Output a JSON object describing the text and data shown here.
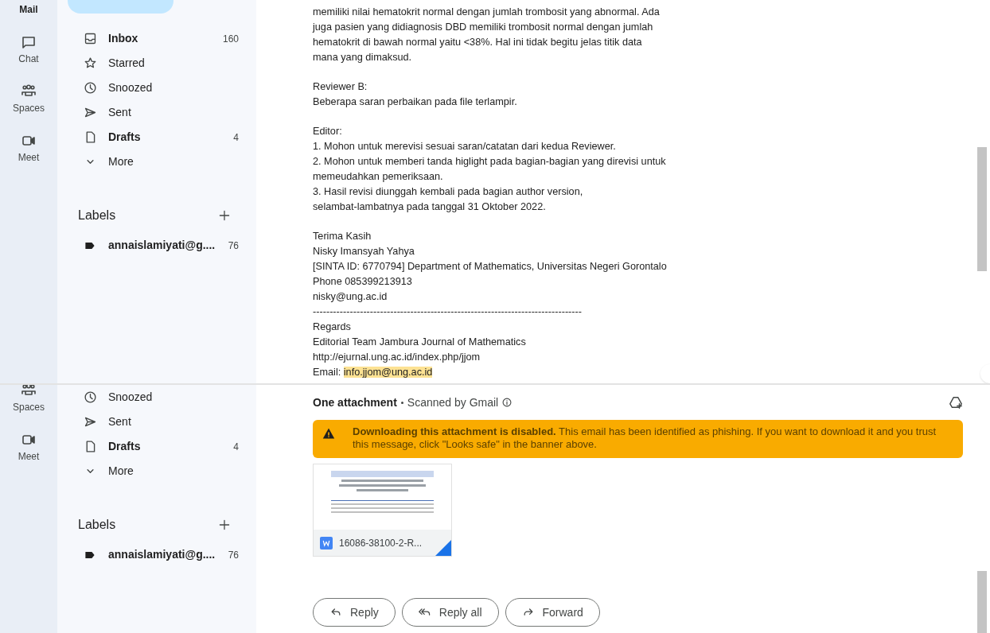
{
  "top_view": {
    "rail": [
      {
        "kind": "mail",
        "label": "Mail"
      },
      {
        "kind": "chat",
        "label": "Chat"
      },
      {
        "kind": "spaces",
        "label": "Spaces"
      },
      {
        "kind": "meet",
        "label": "Meet"
      }
    ],
    "nav": [
      {
        "kind": "inbox",
        "label": "Inbox",
        "count": "160",
        "unread": true
      },
      {
        "kind": "starred",
        "label": "Starred",
        "unread": false
      },
      {
        "kind": "snoozed",
        "label": "Snoozed",
        "unread": false
      },
      {
        "kind": "sent",
        "label": "Sent",
        "unread": false
      },
      {
        "kind": "drafts",
        "label": "Drafts",
        "count": "4",
        "unread": true
      },
      {
        "kind": "more",
        "label": "More",
        "unread": false
      }
    ],
    "labels_heading": "Labels",
    "labels": [
      {
        "name": "annaislamiyati@g....",
        "count": "76"
      }
    ],
    "body": [
      [
        "memiliki nilai hematokrit normal dengan jumlah trombosit yang abnormal. Ada",
        "juga pasien yang didiagnosis DBD memiliki trombosit normal dengan jumlah",
        "hematokrit di bawah normal yaitu <38%. Hal ini tidak begitu jelas titik data",
        "mana yang dimaksud."
      ],
      [
        "Reviewer B:",
        "Beberapa saran perbaikan pada file terlampir."
      ],
      [
        "Editor:",
        "1. Mohon untuk merevisi sesuai saran/catatan dari kedua Reviewer.",
        "2. Mohon untuk memberi tanda higlight pada bagian-bagian yang direvisi untuk",
        "memeudahkan pemeriksaan.",
        "3. Hasil revisi diunggah kembali pada bagian author version,",
        "selambat-lambatnya pada tanggal 31 Oktober 2022."
      ],
      [
        "Terima Kasih",
        "Nisky Imansyah Yahya",
        "[SINTA ID: 6770794] Department of Mathematics, Universitas Negeri Gorontalo",
        "Phone 085399213913",
        "nisky@ung.ac.id",
        "--------------------------------------------------------------------------------",
        "Regards",
        "Editorial Team Jambura Journal of Mathematics",
        "http://ejurnal.ung.ac.id/index.php/jjom",
        {
          "text": "Email: ",
          "highlight": "info.jjom@ung.ac.id"
        }
      ]
    ]
  },
  "bottom_view": {
    "rail": [
      {
        "kind": "spaces",
        "label": "Spaces"
      },
      {
        "kind": "meet",
        "label": "Meet"
      }
    ],
    "nav": [
      {
        "kind": "snoozed",
        "label": "Snoozed",
        "unread": false
      },
      {
        "kind": "sent",
        "label": "Sent",
        "unread": false
      },
      {
        "kind": "drafts",
        "label": "Drafts",
        "count": "4",
        "unread": true
      },
      {
        "kind": "more",
        "label": "More",
        "unread": false
      }
    ],
    "labels_heading": "Labels",
    "labels": [
      {
        "name": "annaislamiyati@g....",
        "count": "76"
      }
    ],
    "attachments_title": "One attachment",
    "scanned": "Scanned by Gmail",
    "warning": "**Downloading this attachment is disabled.** This email has been identified as phishing. If you want to download it and you trust this message, click \"Looks safe\" in the banner above.",
    "attachment": {
      "filename": "16086-38100-2-R..."
    },
    "actions": [
      {
        "kind": "reply",
        "label": "Reply"
      },
      {
        "kind": "reply_all",
        "label": "Reply all"
      },
      {
        "kind": "forward",
        "label": "Forward"
      }
    ]
  }
}
